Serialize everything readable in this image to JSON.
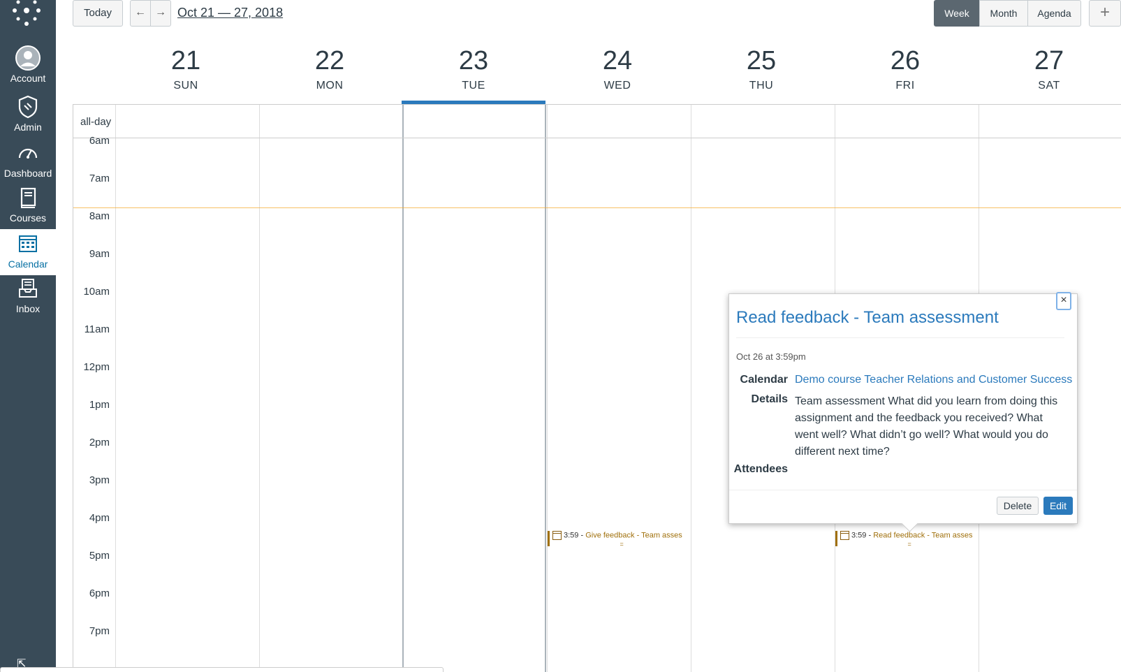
{
  "nav": {
    "items": [
      {
        "label": "Account",
        "icon": "avatar-icon"
      },
      {
        "label": "Admin",
        "icon": "shield-icon"
      },
      {
        "label": "Dashboard",
        "icon": "dashboard-icon"
      },
      {
        "label": "Courses",
        "icon": "book-icon"
      },
      {
        "label": "Calendar",
        "icon": "calendar-icon"
      },
      {
        "label": "Inbox",
        "icon": "inbox-icon"
      }
    ],
    "collapse_icon": "collapse-arrow-icon"
  },
  "header": {
    "today_label": "Today",
    "prev_icon": "←",
    "next_icon": "→",
    "date_range": "Oct 21 — 27, 2018",
    "views": [
      "Week",
      "Month",
      "Agenda"
    ],
    "active_view": "Week",
    "add_label": "+"
  },
  "days": [
    {
      "num": "21",
      "dow": "SUN"
    },
    {
      "num": "22",
      "dow": "MON"
    },
    {
      "num": "23",
      "dow": "TUE"
    },
    {
      "num": "24",
      "dow": "WED"
    },
    {
      "num": "25",
      "dow": "THU"
    },
    {
      "num": "26",
      "dow": "FRI"
    },
    {
      "num": "27",
      "dow": "SAT"
    }
  ],
  "today_index": 2,
  "allday_label": "all-day",
  "hours": [
    "6am",
    "7am",
    "8am",
    "9am",
    "10am",
    "11am",
    "12pm",
    "1pm",
    "2pm",
    "3pm",
    "4pm",
    "5pm",
    "6pm",
    "7pm"
  ],
  "events": [
    {
      "time": "3:59 -",
      "title": "Give feedback - Team asses",
      "resize": "="
    },
    {
      "time": "3:59 -",
      "title": "Read feedback - Team asses",
      "resize": "="
    }
  ],
  "popover": {
    "close_label": "×",
    "title": "Read feedback - Team assessment",
    "date": "Oct 26 at 3:59pm",
    "calendar_label": "Calendar",
    "calendar_value": "Demo course Teacher Relations and Customer Success",
    "details_label": "Details",
    "details_value": "Team assessment What did you learn from doing this assignment and the feedback you received? What went well? What didn’t go well? What would you do different next time?",
    "attendees_label": "Attendees",
    "delete_label": "Delete",
    "edit_label": "Edit"
  },
  "colors": {
    "nav_bg": "#394b58",
    "accent": "#2b7abc",
    "event": "#a0700c",
    "now_line": "#f5a623"
  }
}
